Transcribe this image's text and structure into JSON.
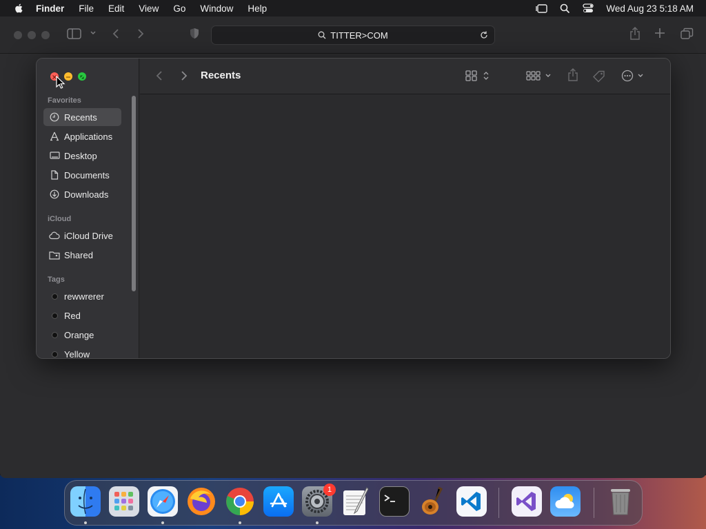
{
  "menubar": {
    "app_name": "Finder",
    "items": [
      "File",
      "Edit",
      "View",
      "Go",
      "Window",
      "Help"
    ],
    "clock": "Wed Aug 23  5:18 AM"
  },
  "safari": {
    "url": "TITTER>COM"
  },
  "finder": {
    "title": "Recents",
    "sidebar": {
      "favorites_title": "Favorites",
      "favorites": [
        {
          "label": "Recents",
          "icon": "clock-icon",
          "selected": true
        },
        {
          "label": "Applications",
          "icon": "applications-icon"
        },
        {
          "label": "Desktop",
          "icon": "desktop-icon"
        },
        {
          "label": "Documents",
          "icon": "document-icon"
        },
        {
          "label": "Downloads",
          "icon": "download-icon"
        }
      ],
      "icloud_title": "iCloud",
      "icloud": [
        {
          "label": "iCloud Drive",
          "icon": "cloud-icon"
        },
        {
          "label": "Shared",
          "icon": "shared-folder-icon"
        }
      ],
      "tags_title": "Tags",
      "tags": [
        {
          "label": "rewwrerer"
        },
        {
          "label": "Red"
        },
        {
          "label": "Orange"
        },
        {
          "label": "Yellow"
        }
      ]
    }
  },
  "dock": {
    "apps": [
      "Finder",
      "Launchpad",
      "Safari",
      "Firefox",
      "Chrome",
      "App Store",
      "System Settings",
      "TextEdit",
      "Terminal",
      "GarageBand",
      "Visual Studio Code",
      "Visual Studio",
      "Weather",
      "Trash"
    ],
    "settings_badge": "1"
  }
}
